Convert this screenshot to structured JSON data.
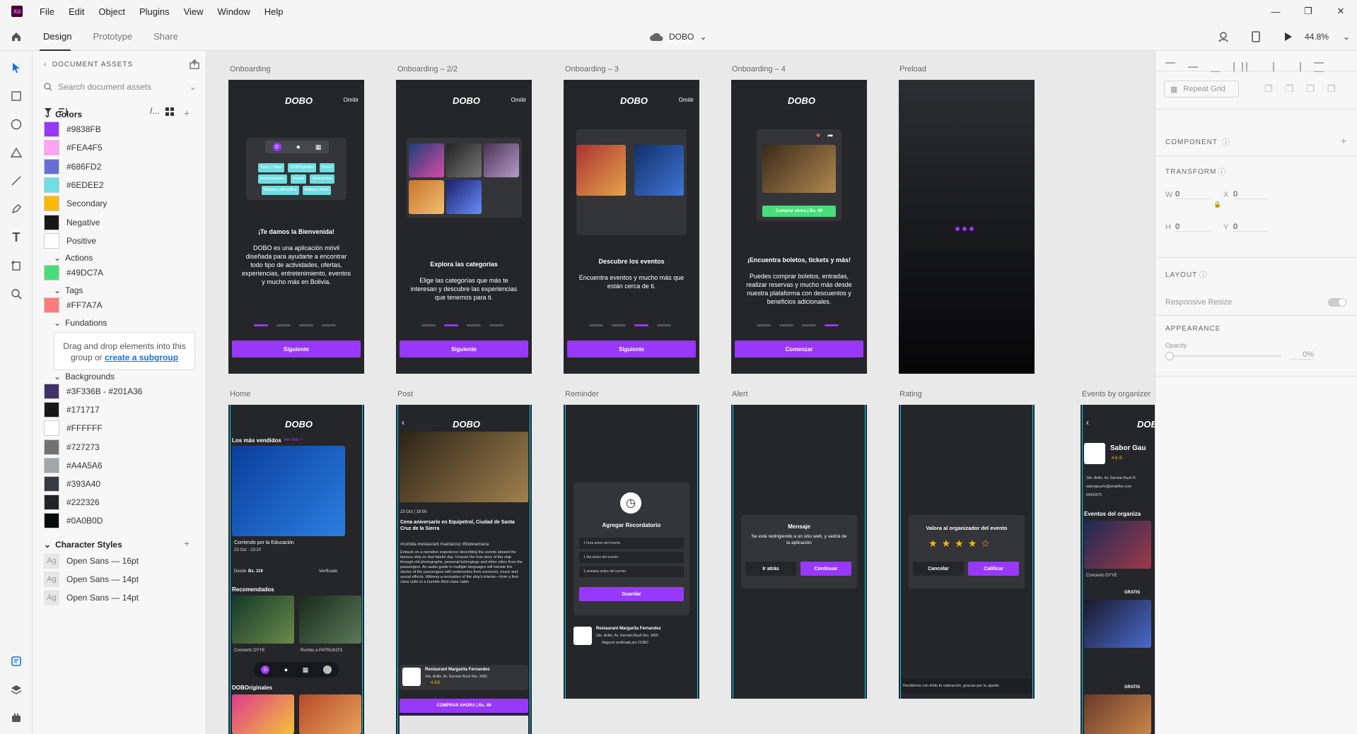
{
  "app": {
    "logo": "Xd",
    "menu": [
      "File",
      "Edit",
      "Object",
      "Plugins",
      "View",
      "Window",
      "Help"
    ]
  },
  "toolbar": {
    "tabs": [
      "Design",
      "Prototype",
      "Share"
    ],
    "active_tab": "Design",
    "document_name": "DOBO",
    "zoom": "44.8%"
  },
  "assets": {
    "header": "DOCUMENT ASSETS",
    "search_placeholder": "Search document assets",
    "colors_title": "Colors",
    "colors": [
      {
        "label": "#9838FB",
        "hex": "#9838FB"
      },
      {
        "label": "#FEA4F5",
        "hex": "#FEA4F5"
      },
      {
        "label": "#686FD2",
        "hex": "#686FD2"
      },
      {
        "label": "#6EDEE2",
        "hex": "#6EDEE2"
      },
      {
        "label": "Secondary",
        "hex": "#FFB800"
      },
      {
        "label": "Negative",
        "hex": "#171717"
      },
      {
        "label": "Positive",
        "hex": "#FFFFFF"
      }
    ],
    "actions_title": "Actions",
    "actions": [
      {
        "label": "#49DC7A",
        "hex": "#49DC7A"
      }
    ],
    "tags_title": "Tags",
    "tags": [
      {
        "label": "#FF7A7A",
        "hex": "#FF7A7A"
      }
    ],
    "fundations_title": "Fundations",
    "drop_text": "Drag and drop elements into this group or",
    "drop_link": "create a subgroup",
    "backgrounds_title": "Backgrounds",
    "backgrounds": [
      {
        "label": "#3F336B - #201A36",
        "hex": "#3F336B"
      },
      {
        "label": "#171717",
        "hex": "#171717"
      },
      {
        "label": "#FFFFFF",
        "hex": "#FFFFFF"
      },
      {
        "label": "#727273",
        "hex": "#727273"
      },
      {
        "label": "#A4A5A6",
        "hex": "#A4A5A6"
      },
      {
        "label": "#393A40",
        "hex": "#393A40"
      },
      {
        "label": "#222326",
        "hex": "#222326"
      },
      {
        "label": "#0A0B0D",
        "hex": "#0A0B0D"
      }
    ],
    "char_styles_title": "Character Styles",
    "char_styles": [
      "Open Sans — 16pt",
      "Open Sans — 14pt",
      "Open Sans — 14pt"
    ],
    "ag": "Ag"
  },
  "artboards": {
    "row1": [
      "Onboarding",
      "Onboarding – 2/2",
      "Onboarding – 3",
      "Onboarding – 4",
      "Preload"
    ],
    "row2": [
      "Home",
      "Post",
      "Reminder",
      "Alert",
      "Rating",
      "Events by organizer"
    ],
    "brand": "DOBO",
    "skip": "Omitir",
    "onb1_title": "¡Te damos la Bienvenida!",
    "onb1_body": "DOBO es una aplicación móvil diseñada para ayudarte a encontrar todo tipo de actividades, ofertas, experiencias, entretenimiento, eventos y mucho más en Bolivia.",
    "onb1_tags": [
      "Tours y Viajes",
      "DOBOriginales",
      "Para 2",
      "Recomendados",
      "Fiestas",
      "Gastronomía",
      "Baladas y AfterOffice",
      "Belleza y Moda"
    ],
    "onb2_title": "Explora las categorías",
    "onb2_body": "Elige las categorías que más te interesan y descubre las experiencias que tenemos para ti.",
    "onb3_title": "Descubre los eventos",
    "onb3_body": "Encuentra eventos y mucho más que están cerca de ti.",
    "onb4_title": "¡Encuentra boletos, tickets y más!",
    "onb4_body": "Puedes comprar boletos, entradas, realizar reservas y mucho más desde nuestra plataforma con descuentos y beneficios adicionales.",
    "onb4_buy": "Comprar ahora | Bs. 49",
    "next": "Siguiente",
    "start": "Comenzar",
    "home_most_sold": "Los más vendidos",
    "see_more": "Ver más >",
    "home_event": "Corriendo por la Educación",
    "home_event_date": "23 Oct - 23:20",
    "home_price_from": "Desde",
    "home_price": "Bs. 119",
    "verified": "Verificado",
    "home_recommended": "Recomendados",
    "home_rec1": "Concierto DYYE",
    "home_rec2": "Rumbo a PATRUKO'S",
    "home_doboriginales": "DOBOriginales",
    "post_date": "23 Oct | 19:00",
    "post_title": "Cena aniversario en Equipetrol, Ciudad de Santa Cruz de la Sierra",
    "post_hashtags": "#comida #restaurant #santacruz #findesemana",
    "post_body": "Embark on a narrative experience describing the events aboard the famous ship on that fateful day. Unravel the true story of the ship through old photographs, personal belongings and other relics from the passengers. An audio guide in multiple languages will narrate the stories of the passengers with testimonies from survivors, music and sound effects. Witness a recreation of the ship's interior—from a first-class suite to a humble third-class cabin",
    "post_org": "Restaurant Margarita Fernandez",
    "post_org_addr": "2do. Anillo, Av. Germán Bush Nro. 3456",
    "post_rating": "4.9/5",
    "post_buy": "COMPRAR AHORA | Bs. 49",
    "reminder_title": "Agregar Recordatorio",
    "reminder_opts": [
      "1 hora antes del evento",
      "1 día antes del evento",
      "1 semana antes del evento"
    ],
    "reminder_save": "Guardar",
    "reminder_verified": "Negocio verificado por DOBO",
    "alert_title": "Mensaje",
    "alert_body": "Se está redirigiendo a un sitio web, y saldrá de la aplicación",
    "alert_back": "Ir atrás",
    "alert_continue": "Continuar",
    "rating_title": "Valora al organizador del evento",
    "rating_cancel": "Cancelar",
    "rating_submit": "Calificar",
    "rating_footer": "Recibimos con éxito tu valoración, gracias por tu aporte.",
    "org_name": "Sabor Gau",
    "org_rating": "4.6 /5",
    "org_addr": "2do. Anillo, Av. Germán Bush N",
    "org_email": "saborgaucho@smaillive.com",
    "org_phone": "60432575",
    "org_events": "Eventos del organiza",
    "org_event1": "Concierto DYYE",
    "org_free": "GRATIS"
  },
  "props": {
    "repeat_grid": "Repeat Grid",
    "component": "COMPONENT",
    "transform": "TRANSFORM",
    "w_label": "W",
    "w": "0",
    "x_label": "X",
    "x": "0",
    "h_label": "H",
    "h": "0",
    "y_label": "Y",
    "y": "0",
    "layout": "LAYOUT",
    "responsive": "Responsive Resize",
    "appearance": "APPEARANCE",
    "opacity_label": "Opacity",
    "opacity": "0%"
  }
}
